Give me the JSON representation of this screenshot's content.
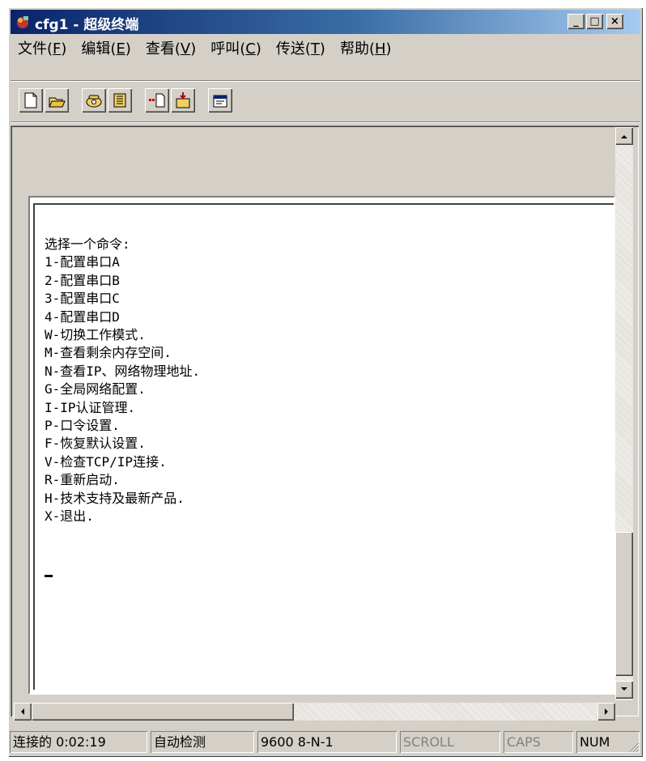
{
  "window": {
    "title": "cfg1 - 超级终端",
    "controls": {
      "minimize": "_",
      "maximize": "□",
      "close": "×"
    }
  },
  "menu": [
    {
      "label": "文件(",
      "accel": "F",
      "tail": ")"
    },
    {
      "label": "编辑(",
      "accel": "E",
      "tail": ")"
    },
    {
      "label": "查看(",
      "accel": "V",
      "tail": ")"
    },
    {
      "label": "呼叫(",
      "accel": "C",
      "tail": ")"
    },
    {
      "label": "传送(",
      "accel": "T",
      "tail": ")"
    },
    {
      "label": "帮助(",
      "accel": "H",
      "tail": ")"
    }
  ],
  "toolbar": {
    "buttons": [
      "new-icon",
      "open-icon",
      "phone-call-icon",
      "hangup-icon",
      "send-file-icon",
      "receive-file-icon",
      "properties-icon"
    ]
  },
  "terminal": {
    "lines": [
      "选择一个命令:",
      "1-配置串口A",
      "2-配置串口B",
      "3-配置串口C",
      "4-配置串口D",
      "W-切换工作模式.",
      "M-查看剩余内存空间.",
      "N-查看IP、网络物理地址.",
      "G-全局网络配置.",
      "I-IP认证管理.",
      "P-口令设置.",
      "F-恢复默认设置.",
      "V-检查TCP/IP连接.",
      "R-重新启动.",
      "H-技术支持及最新产品.",
      "X-退出."
    ]
  },
  "status": {
    "connected": "连接的 0:02:19",
    "detect": "自动检测",
    "port": "9600 8-N-1",
    "scroll": "SCROLL",
    "caps": "CAPS",
    "num": "NUM"
  },
  "colors": {
    "title_start": "#0a246a",
    "title_end": "#a6caf0",
    "face": "#d4d0c8"
  }
}
